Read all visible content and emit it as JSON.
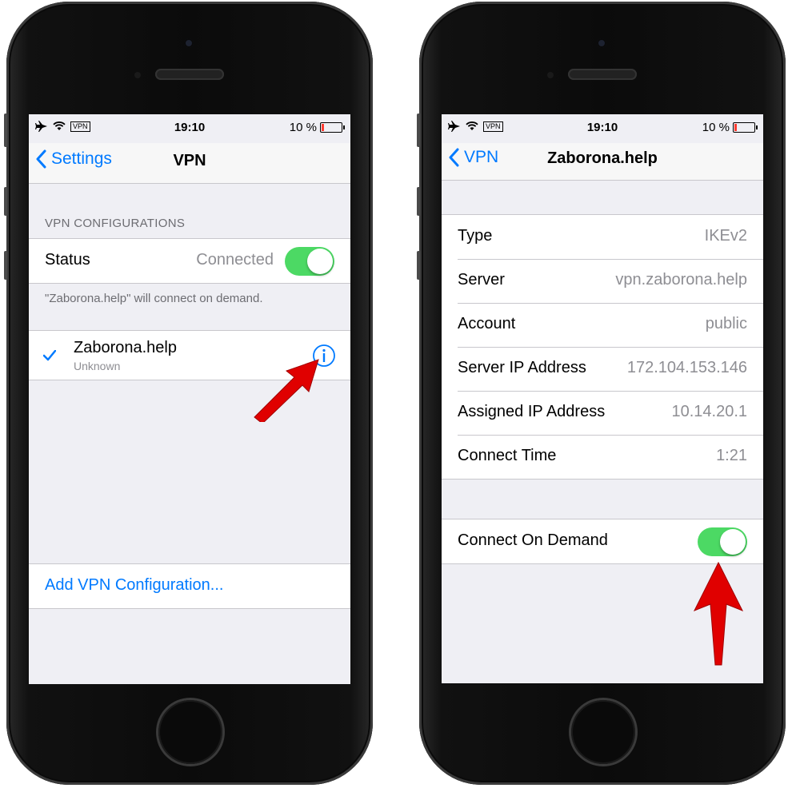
{
  "status_bar": {
    "time": "19:10",
    "vpn_badge": "VPN",
    "battery": "10 %"
  },
  "left_screen": {
    "nav": {
      "back_label": "Settings",
      "title": "VPN"
    },
    "section_header": "VPN CONFIGURATIONS",
    "status_row": {
      "label": "Status",
      "value": "Connected",
      "toggle_on": true
    },
    "footer_note": "\"Zaborona.help\" will connect on demand.",
    "config_item": {
      "name": "Zaborona.help",
      "subtitle": "Unknown",
      "selected": true
    },
    "add_link": "Add VPN Configuration..."
  },
  "right_screen": {
    "nav": {
      "back_label": "VPN",
      "title": "Zaborona.help"
    },
    "details": [
      {
        "label": "Type",
        "value": "IKEv2"
      },
      {
        "label": "Server",
        "value": "vpn.zaborona.help"
      },
      {
        "label": "Account",
        "value": "public"
      },
      {
        "label": "Server IP Address",
        "value": "172.104.153.146"
      },
      {
        "label": "Assigned IP Address",
        "value": "10.14.20.1"
      },
      {
        "label": "Connect Time",
        "value": "1:21"
      }
    ],
    "connect_on_demand": {
      "label": "Connect On Demand",
      "toggle_on": true
    }
  },
  "colors": {
    "accent": "#007aff",
    "toggle_on": "#4cd964",
    "arrow": "#e00000",
    "background": "#efeff4"
  }
}
